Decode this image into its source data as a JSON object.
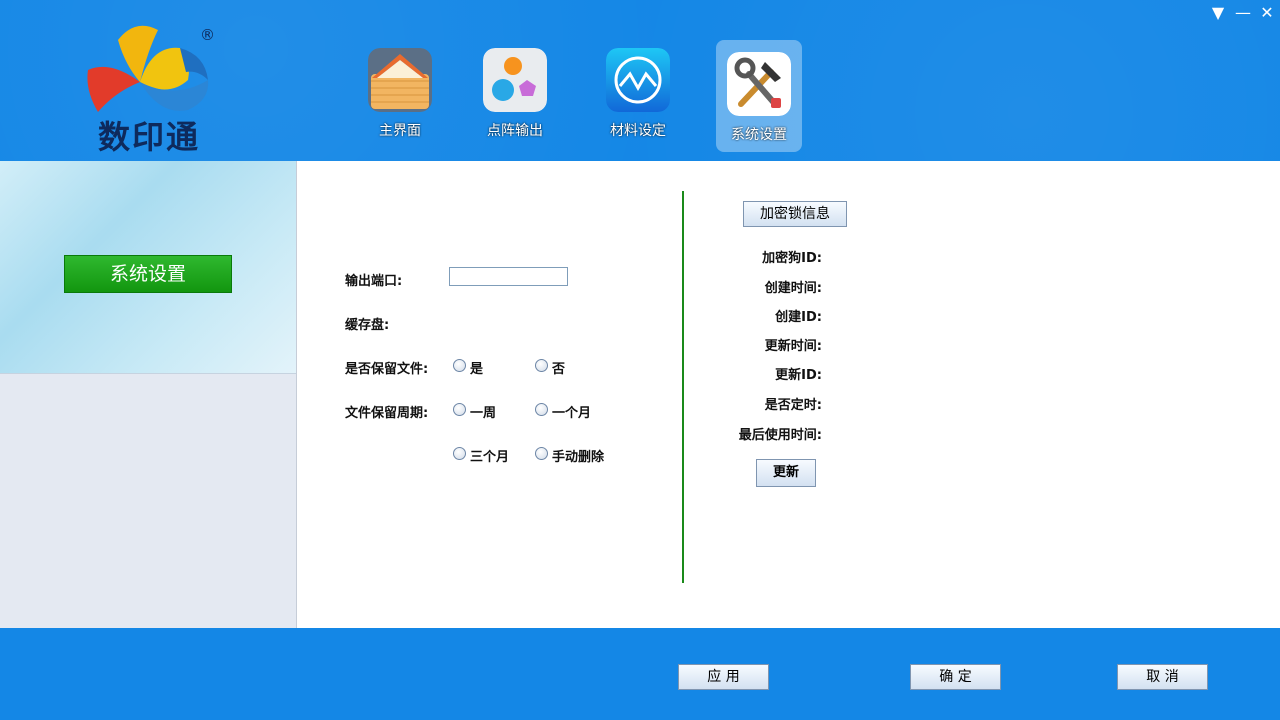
{
  "app": {
    "logo_text": "数印通",
    "registered_mark": "®"
  },
  "window_controls": {
    "menu_icon": "▼",
    "minimize_icon": "—",
    "close_icon": "✕"
  },
  "nav": {
    "items": [
      {
        "label": "主界面",
        "icon": "home-icon"
      },
      {
        "label": "点阵输出",
        "icon": "dots-icon"
      },
      {
        "label": "材料设定",
        "icon": "materials-icon"
      },
      {
        "label": "系统设置",
        "icon": "tools-icon",
        "active": true
      }
    ]
  },
  "sidebar": {
    "button_label": "系统设置"
  },
  "settings": {
    "output_port_label": "输出端口:",
    "output_port_value": "",
    "cache_disk_label": "缓存盘:",
    "keep_files_label": "是否保留文件:",
    "keep_files_options": [
      "是",
      "否"
    ],
    "retention_label": "文件保留周期:",
    "retention_options": [
      "一周",
      "一个月",
      "三个月",
      "手动删除"
    ]
  },
  "dongle": {
    "info_button": "加密锁信息",
    "fields": [
      "加密狗ID:",
      "创建时间:",
      "创建ID:",
      "更新时间:",
      "更新ID:",
      "是否定时:",
      "最后使用时间:"
    ],
    "update_button": "更新"
  },
  "footer": {
    "apply": "应 用",
    "ok": "确 定",
    "cancel": "取 消"
  },
  "colors": {
    "header_blue": "#1487e6",
    "active_green": "#12960f",
    "divider_green": "#1a8a1a"
  }
}
